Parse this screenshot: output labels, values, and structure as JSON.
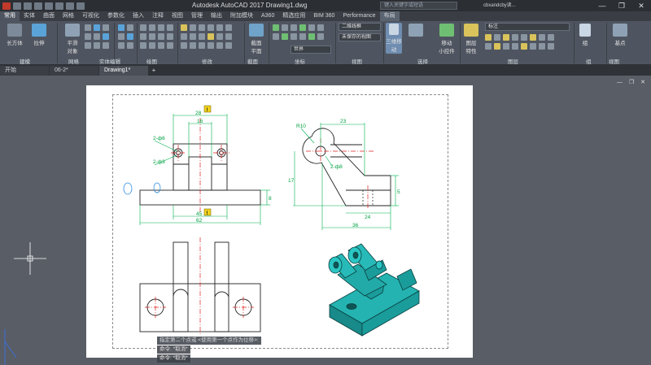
{
  "window": {
    "title": "Autodesk AutoCAD 2017    Drawing1.dwg",
    "search_placeholder": "键入关键字或短语",
    "user": "cbxandcby读...",
    "minimize": "—",
    "maximize": "❐",
    "close": "✕"
  },
  "ribbon_tabs": [
    "常用",
    "实体",
    "曲面",
    "网格",
    "可视化",
    "参数化",
    "插入",
    "注释",
    "视图",
    "管理",
    "输出",
    "附加模块",
    "A360",
    "精选应用",
    "BIM 360",
    "Performance",
    "布局"
  ],
  "ribbon": {
    "tools": {
      "box": "长方体",
      "extrude": "拉伸",
      "smooth": "平滑\n对象",
      "section_plane": "截面\n平面",
      "gizmo": "三维移动",
      "layer_props": "图层\n特性",
      "group": "组",
      "base": "基点",
      "move_gizmo": "移动\n小控件"
    },
    "combos": {
      "visual_style": "二维线框",
      "unsaved_view": "未保存的视图",
      "world": "世界",
      "layer": "标注"
    },
    "panels": [
      "建模",
      "网格",
      "实体编辑",
      "绘图",
      "修改",
      "截面",
      "坐标",
      "视图",
      "选择",
      "图层",
      "组",
      "视图"
    ]
  },
  "doc_tabs": [
    "开始",
    "06-2*",
    "Drawing1*"
  ],
  "viewport_ctrls": "— ❐ ✕",
  "command_lines": [
    "指定第二个点或 <使用第一个点作为位移>:",
    "命令: *取消*",
    "命令: *取消*"
  ],
  "dimensions": {
    "top_28": "28",
    "top_16": "16",
    "circle_phi6": "2-ф6",
    "circle_phi3": "2-ф3",
    "height_8": "8",
    "width_45": "45",
    "width_62": "62",
    "side_R10": "R10",
    "side_23": "23",
    "side_phi8": "2-ф8",
    "side_17": "17",
    "side_5": "5",
    "side_24": "24",
    "side_36": "36",
    "marker": "!"
  },
  "colors": {
    "accent_cyan": "#1fa7a6",
    "dim_green": "#00b050",
    "center_red": "#e02020",
    "ribbon_bg": "#4f5560"
  }
}
